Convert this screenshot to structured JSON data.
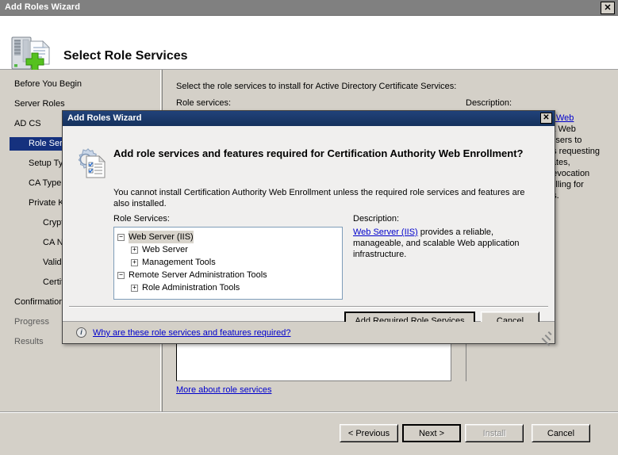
{
  "window": {
    "title": "Add Roles Wizard",
    "close_label": "✕",
    "close_icon": "close-icon",
    "header_title": "Select Role Services",
    "header_icon": "server-add-icon"
  },
  "sidebar": {
    "items": [
      {
        "label": "Before You Begin",
        "level": 0,
        "selected": false,
        "dim": false
      },
      {
        "label": "Server Roles",
        "level": 0,
        "selected": false,
        "dim": false
      },
      {
        "label": "AD CS",
        "level": 0,
        "selected": false,
        "dim": false
      },
      {
        "label": "Role Services",
        "level": 1,
        "selected": true,
        "dim": false
      },
      {
        "label": "Setup Type",
        "level": 1,
        "selected": false,
        "dim": false
      },
      {
        "label": "CA Type",
        "level": 1,
        "selected": false,
        "dim": false
      },
      {
        "label": "Private Key",
        "level": 1,
        "selected": false,
        "dim": false
      },
      {
        "label": "Cryptography",
        "level": 2,
        "selected": false,
        "dim": false
      },
      {
        "label": "CA Name",
        "level": 2,
        "selected": false,
        "dim": false
      },
      {
        "label": "Validity Period",
        "level": 2,
        "selected": false,
        "dim": false
      },
      {
        "label": "Certificate Database",
        "level": 2,
        "selected": false,
        "dim": false
      },
      {
        "label": "Confirmation",
        "level": 0,
        "selected": false,
        "dim": false
      },
      {
        "label": "Progress",
        "level": 0,
        "selected": false,
        "dim": true
      },
      {
        "label": "Results",
        "level": 0,
        "selected": false,
        "dim": true
      }
    ]
  },
  "main": {
    "intro": "Select the role services to install for Active Directory Certificate Services:",
    "roles_label": "Role services:",
    "description_label": "Description:",
    "description_link": "Certification Authority Web Enrollment",
    "description_body_lines": [
      "provides a Web interface that",
      "allows users to perform tasks such as",
      "requesting and renewing certificates,",
      "retrieving certificate revocation lists",
      "(CRLs), and enrolling for smart card",
      "certificates."
    ],
    "more_link": "More about role services"
  },
  "footer": {
    "previous": "< Previous",
    "next": "Next >",
    "install": "Install",
    "cancel": "Cancel"
  },
  "dialog": {
    "title": "Add Roles Wizard",
    "close_label": "✕",
    "close_icon": "close-icon",
    "icon": "gear-checklist-icon",
    "heading": "Add role services and features required for Certification Authority Web Enrollment?",
    "subtext": "You cannot install Certification Authority Web Enrollment unless the required role services and features are also installed.",
    "role_services_label": "Role Services:",
    "description_label": "Description:",
    "tree": [
      {
        "label": "Web Server (IIS)",
        "indent": 0,
        "toggle": "−",
        "highlighted": true
      },
      {
        "label": "Web Server",
        "indent": 1,
        "toggle": "+",
        "highlighted": false
      },
      {
        "label": "Management Tools",
        "indent": 1,
        "toggle": "+",
        "highlighted": false
      },
      {
        "label": "Remote Server Administration Tools",
        "indent": 0,
        "toggle": "−",
        "highlighted": false
      },
      {
        "label": "Role Administration Tools",
        "indent": 1,
        "toggle": "+",
        "highlighted": false
      }
    ],
    "description_link": "Web Server (IIS)",
    "description_rest": " provides a reliable, manageable, and scalable Web application infrastructure.",
    "add_button": "Add Required Role Services",
    "cancel_button": "Cancel",
    "info_icon_glyph": "i",
    "footer_link": "Why are these role services and features required?"
  },
  "colors": {
    "window_titlebar": "#808080",
    "dialog_titlebar": "#15317e",
    "selection": "#15317e",
    "link": "#0000cc",
    "face": "#d4d0c8"
  }
}
